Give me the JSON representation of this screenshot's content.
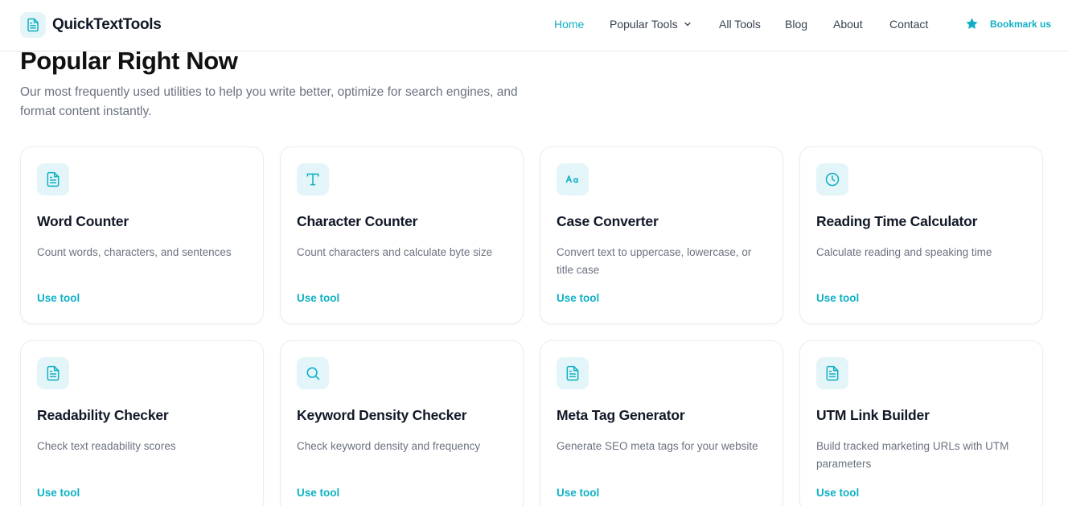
{
  "brand": {
    "name": "QuickTextTools",
    "logo_icon": "document-icon"
  },
  "nav": {
    "items": [
      {
        "label": "Home",
        "active": true
      },
      {
        "label": "Popular Tools",
        "has_dropdown": true
      },
      {
        "label": "All Tools"
      },
      {
        "label": "Blog"
      },
      {
        "label": "About"
      },
      {
        "label": "Contact"
      }
    ],
    "bookmark_label": "Bookmark us",
    "bookmark_icon": "star-icon"
  },
  "hero": {
    "title": "Popular Right Now",
    "subtitle": "Our most frequently used utilities to help you write better, optimize for search engines, and format content instantly."
  },
  "colors": {
    "accent": "#0fb0c4",
    "icon_bg": "#e3f5f8",
    "text": "#111827",
    "muted": "#6b7280"
  },
  "tools": [
    {
      "title": "Word Counter",
      "description": "Count words, characters, and sentences",
      "link": "Use tool",
      "icon": "document-icon"
    },
    {
      "title": "Character Counter",
      "description": "Count characters and calculate byte size",
      "link": "Use tool",
      "icon": "type-t-icon"
    },
    {
      "title": "Case Converter",
      "description": "Convert text to uppercase, lowercase, or title case",
      "link": "Use tool",
      "icon": "case-aa-icon"
    },
    {
      "title": "Reading Time Calculator",
      "description": "Calculate reading and speaking time",
      "link": "Use tool",
      "icon": "clock-icon"
    },
    {
      "title": "Readability Checker",
      "description": "Check text readability scores",
      "link": "Use tool",
      "icon": "document-icon"
    },
    {
      "title": "Keyword Density Checker",
      "description": "Check keyword density and frequency",
      "link": "Use tool",
      "icon": "search-icon"
    },
    {
      "title": "Meta Tag Generator",
      "description": "Generate SEO meta tags for your website",
      "link": "Use tool",
      "icon": "document-icon"
    },
    {
      "title": "UTM Link Builder",
      "description": "Build tracked marketing URLs with UTM parameters",
      "link": "Use tool",
      "icon": "document-icon"
    }
  ]
}
